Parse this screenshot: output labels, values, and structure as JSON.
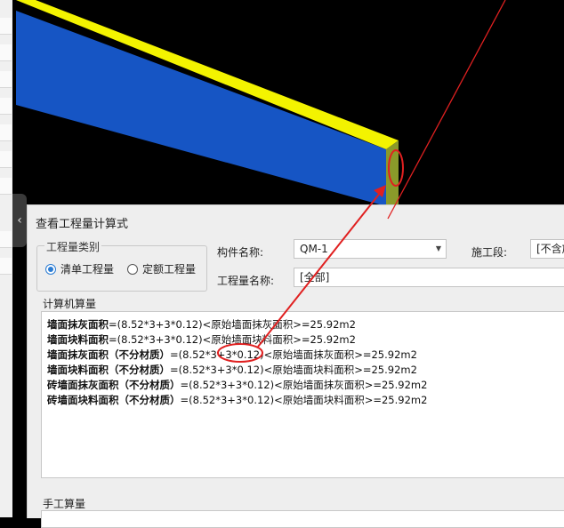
{
  "colors": {
    "wall_top": "#f3f300",
    "wall_front": "#1655c4",
    "wall_side": "#8a9a2a",
    "annotation": "#e02020",
    "radio_accent": "#2b7cd3"
  },
  "dialog": {
    "title": "查看工程量计算式",
    "quantity_type": {
      "group_label": "工程量类别",
      "options": [
        {
          "label": "清单工程量",
          "selected": true
        },
        {
          "label": "定额工程量",
          "selected": false
        }
      ]
    },
    "component_name": {
      "label": "构件名称:",
      "value": "QM-1"
    },
    "construction_stage": {
      "label": "施工段:",
      "value": "[不含施"
    },
    "quantity_name": {
      "label": "工程量名称:",
      "value": "[全部]"
    },
    "computer_calc": {
      "group_label": "计算机算量",
      "lines": [
        {
          "name": "墙面抹灰面积",
          "formula": "=(8.52*3+3*0.12)<原始墙面抹灰面积>=25.92m2"
        },
        {
          "name": "墙面块料面积",
          "formula": "=(8.52*3+3*0.12)<原始墙面块料面积>=25.92m2"
        },
        {
          "name": "墙面抹灰面积（不分材质）",
          "formula": "=(8.52*3+3*0.12)<原始墙面抹灰面积>=25.92m2"
        },
        {
          "name": "墙面块料面积（不分材质）",
          "formula": "=(8.52*3+3*0.12)<原始墙面块料面积>=25.92m2"
        },
        {
          "name": "砖墙面抹灰面积（不分材质）",
          "formula": "=(8.52*3+3*0.12)<原始墙面抹灰面积>=25.92m2"
        },
        {
          "name": "砖墙面块料面积（不分材质）",
          "formula": "=(8.52*3+3*0.12)<原始墙面块料面积>=25.92m2"
        }
      ]
    },
    "manual_calc": {
      "group_label": "手工算量"
    }
  },
  "panel_collapse_glyph": "‹"
}
